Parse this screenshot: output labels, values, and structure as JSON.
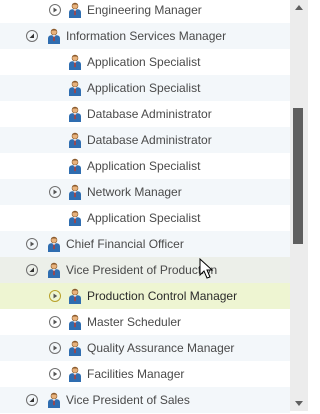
{
  "tree": {
    "rows": [
      {
        "label": "Engineering Manager",
        "level": 2,
        "expander": "collapsed",
        "state": "normal"
      },
      {
        "label": "Information Services Manager",
        "level": 1,
        "expander": "expanded",
        "state": "normal"
      },
      {
        "label": "Application Specialist",
        "level": 2,
        "expander": "none",
        "state": "normal"
      },
      {
        "label": "Application Specialist",
        "level": 2,
        "expander": "none",
        "state": "normal"
      },
      {
        "label": "Database Administrator",
        "level": 2,
        "expander": "none",
        "state": "normal"
      },
      {
        "label": "Database Administrator",
        "level": 2,
        "expander": "none",
        "state": "normal"
      },
      {
        "label": "Application Specialist",
        "level": 2,
        "expander": "none",
        "state": "normal"
      },
      {
        "label": "Network Manager",
        "level": 2,
        "expander": "collapsed",
        "state": "normal"
      },
      {
        "label": "Application Specialist",
        "level": 2,
        "expander": "none",
        "state": "normal"
      },
      {
        "label": "Chief Financial Officer",
        "level": 1,
        "expander": "collapsed",
        "state": "normal"
      },
      {
        "label": "Vice President of Production",
        "level": 1,
        "expander": "expanded",
        "state": "hover"
      },
      {
        "label": "Production Control Manager",
        "level": 2,
        "expander": "collapsed",
        "state": "selected"
      },
      {
        "label": "Master Scheduler",
        "level": 2,
        "expander": "collapsed",
        "state": "normal"
      },
      {
        "label": "Quality Assurance Manager",
        "level": 2,
        "expander": "collapsed",
        "state": "normal"
      },
      {
        "label": "Facilities Manager",
        "level": 2,
        "expander": "collapsed",
        "state": "normal"
      },
      {
        "label": "Vice President of Sales",
        "level": 1,
        "expander": "expanded",
        "state": "normal"
      }
    ]
  },
  "icons": {
    "row_icon": "employee-icon",
    "expand_icon": "expander-arrow-icon"
  },
  "colors": {
    "alt_row": "#f3f7fa",
    "hover_row": "#ecefe9",
    "selected_row": "#eef5d2",
    "text": "#4a4a4a",
    "scroll_thumb": "#5e5e5e"
  }
}
